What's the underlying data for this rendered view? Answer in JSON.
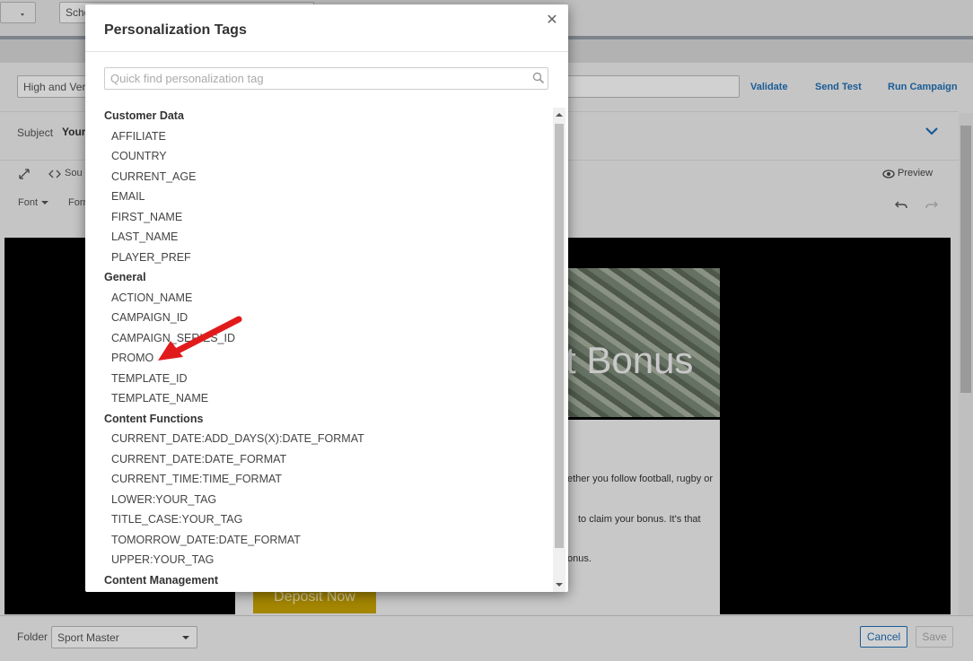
{
  "background": {
    "schedule_prefix": "Sche",
    "campaign_name_value": "High and Ver",
    "actions": {
      "validate": "Validate",
      "send_test": "Send Test",
      "run_campaign": "Run Campaign"
    },
    "subject_label": "Subject",
    "subject_value": "Your",
    "toolbar": {
      "source": "Sou",
      "preview": "Preview",
      "font": "Font",
      "format": "Form"
    },
    "email": {
      "banner_text": "t Bonus",
      "line1": "ether you follow football, rugby or",
      "line2": "to claim your bonus. It's that",
      "line3": "onus.",
      "deposit_button": "Deposit Now"
    },
    "footer": {
      "folder_label": "Folder",
      "folder_value": "Sport Master",
      "cancel": "Cancel",
      "save": "Save"
    }
  },
  "modal": {
    "title": "Personalization Tags",
    "search_placeholder": "Quick find personalization tag",
    "groups": [
      {
        "name": "Customer Data",
        "items": [
          "AFFILIATE",
          "COUNTRY",
          "CURRENT_AGE",
          "EMAIL",
          "FIRST_NAME",
          "LAST_NAME",
          "PLAYER_PREF"
        ]
      },
      {
        "name": "General",
        "items": [
          "ACTION_NAME",
          "CAMPAIGN_ID",
          "CAMPAIGN_SERIES_ID",
          "PROMO",
          "TEMPLATE_ID",
          "TEMPLATE_NAME"
        ]
      },
      {
        "name": "Content Functions",
        "items": [
          "CURRENT_DATE:ADD_DAYS(X):DATE_FORMAT",
          "CURRENT_DATE:DATE_FORMAT",
          "CURRENT_TIME:TIME_FORMAT",
          "LOWER:YOUR_TAG",
          "TITLE_CASE:YOUR_TAG",
          "TOMORROW_DATE:DATE_FORMAT",
          "UPPER:YOUR_TAG"
        ]
      },
      {
        "name": "Content Management",
        "items": []
      }
    ]
  },
  "colors": {
    "accent": "#2071b8",
    "annotation_arrow": "#e11b1b",
    "deposit": "#c9a400"
  }
}
